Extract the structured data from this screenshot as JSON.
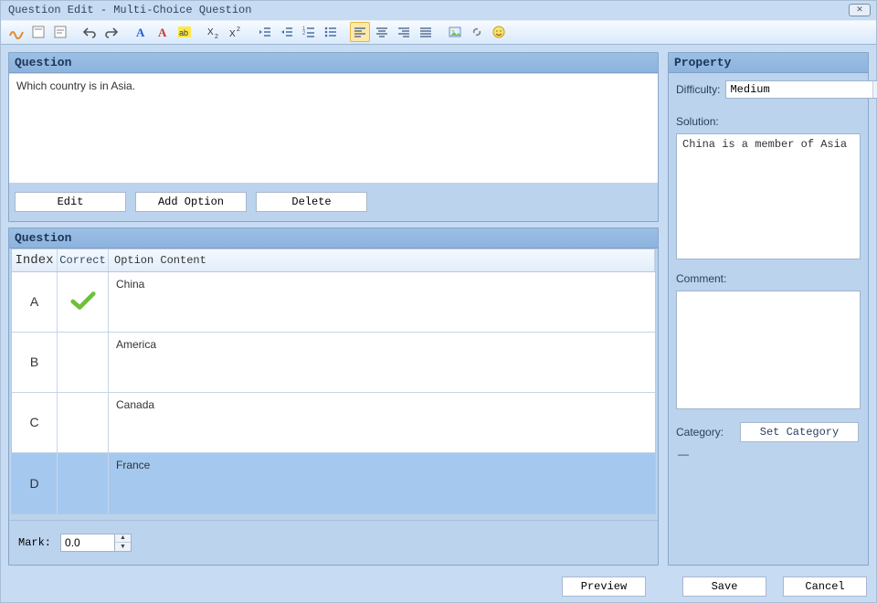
{
  "window": {
    "title": "Question Edit - Multi-Choice Question"
  },
  "toolbar_icons": [
    "signature-icon",
    "text-frame-icon",
    "text-frame2-icon",
    "undo-icon",
    "redo-icon",
    "font-a-blue-icon",
    "font-a-red-icon",
    "highlight-ab-icon",
    "subscript-icon",
    "superscript-icon",
    "outdent-icon",
    "indent-icon",
    "numbered-list-icon",
    "bulleted-list-icon",
    "align-left-icon",
    "align-center-icon",
    "align-right-icon",
    "align-justify-icon",
    "image-icon",
    "link-icon",
    "smiley-icon"
  ],
  "question_panel": {
    "title": "Question",
    "text": "Which country is in Asia."
  },
  "buttons": {
    "edit": "Edit",
    "add_option": "Add Option",
    "delete": "Delete"
  },
  "options_panel": {
    "title": "Question",
    "headers": {
      "index": "Index",
      "correct": "Correct",
      "content": "Option Content"
    },
    "rows": [
      {
        "index": "A",
        "correct": true,
        "content": "China",
        "selected": false
      },
      {
        "index": "B",
        "correct": false,
        "content": "America",
        "selected": false
      },
      {
        "index": "C",
        "correct": false,
        "content": "Canada",
        "selected": false
      },
      {
        "index": "D",
        "correct": false,
        "content": "France",
        "selected": true
      }
    ]
  },
  "mark": {
    "label": "Mark:",
    "value": "0.0"
  },
  "property": {
    "title": "Property",
    "difficulty_label": "Difficulty:",
    "difficulty_value": "Medium",
    "solution_label": "Solution:",
    "solution_value": "China is a member of Asia",
    "comment_label": "Comment:",
    "comment_value": "",
    "category_label": "Category:",
    "set_category_btn": "Set Category",
    "category_value": "—"
  },
  "footer": {
    "preview": "Preview",
    "save": "Save",
    "cancel": "Cancel"
  }
}
